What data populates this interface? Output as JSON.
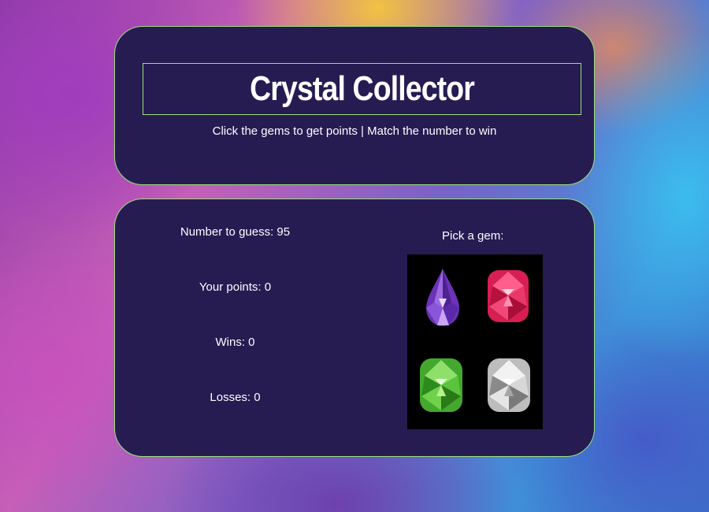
{
  "header": {
    "title": "Crystal Collector",
    "subtitle": "Click the gems to get points | Match the number to win"
  },
  "stats": {
    "number_to_guess": "Number to guess: 95",
    "your_points": "Your points: 0",
    "wins": "Wins: 0",
    "losses": "Losses: 0"
  },
  "gems": {
    "label": "Pick a gem:",
    "items": [
      {
        "name": "purple-gem-icon",
        "color": "#7a3fc8"
      },
      {
        "name": "red-gem-icon",
        "color": "#e02a5a"
      },
      {
        "name": "green-gem-icon",
        "color": "#4fb83a"
      },
      {
        "name": "white-gem-icon",
        "color": "#d8d8d8"
      }
    ]
  },
  "colors": {
    "panel": "#261c52",
    "border": "#9be07a"
  }
}
